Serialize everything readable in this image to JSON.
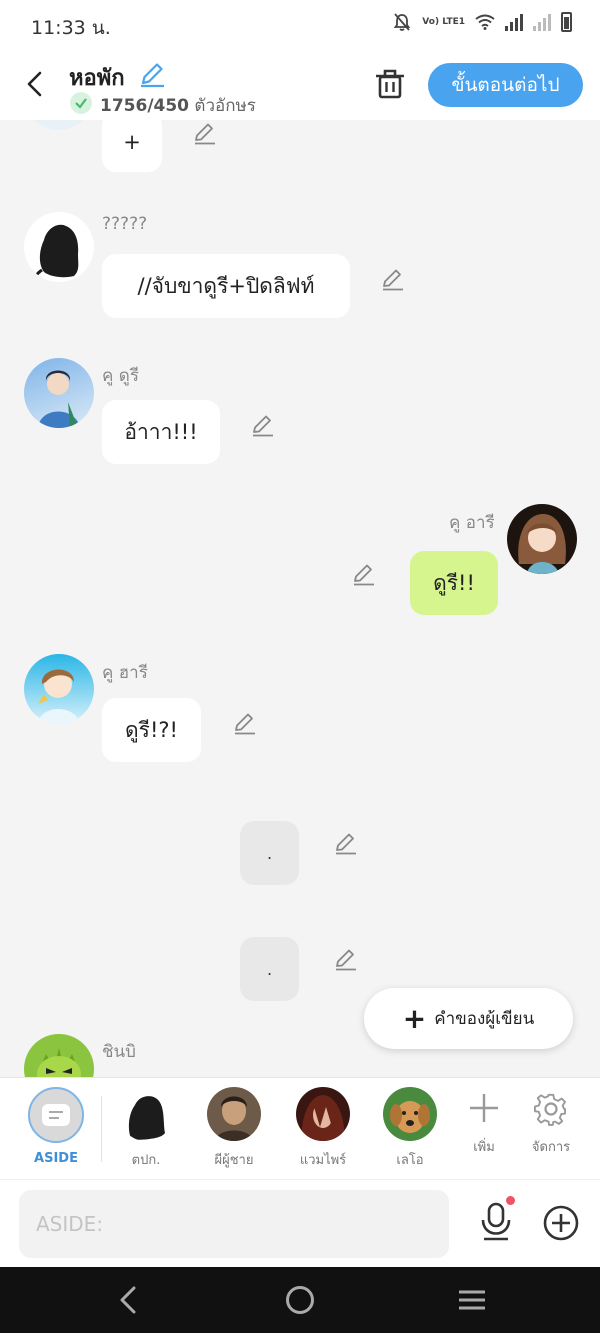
{
  "status_bar": {
    "time": "11:33 น.",
    "volte_label": "Vo) LTE1"
  },
  "header": {
    "title": "หอพัก",
    "char_count": "1756/450",
    "char_count_unit": "ตัวอักษร",
    "next_button": "ขั้นตอนต่อไป"
  },
  "messages": [
    {
      "sender": "",
      "text": "+",
      "side": "left"
    },
    {
      "sender": "?????",
      "text": "//จับขาดูรี+ปิดลิฟท์",
      "side": "left"
    },
    {
      "sender": "คู ดูรี",
      "text": "อ้าาา!!!",
      "side": "left"
    },
    {
      "sender": "คู อารี",
      "text": "ดูรี!!",
      "side": "right"
    },
    {
      "sender": "คู ฮารี",
      "text": "ดูรี!?!",
      "side": "left"
    },
    {
      "sender": "",
      "text": ".",
      "side": "center"
    },
    {
      "sender": "",
      "text": ".",
      "side": "center"
    },
    {
      "sender": "ชินบิ",
      "text": "",
      "side": "left"
    }
  ],
  "writer_button": {
    "label": "คำของผู้เขียน"
  },
  "characters": [
    {
      "label": "ASIDE",
      "active": true
    },
    {
      "label": "ตปก.",
      "active": false
    },
    {
      "label": "ผีผู้ชาย",
      "active": false
    },
    {
      "label": "แวมไพร์",
      "active": false
    },
    {
      "label": "เลโอ",
      "active": false
    }
  ],
  "actions": {
    "add_label": "เพิ่ม",
    "manage_label": "จัดการ"
  },
  "input": {
    "placeholder": "ASIDE:"
  },
  "colors": {
    "accent": "#4aa3ef",
    "own_bubble": "#d6f58e",
    "active_label": "#3f8fd8",
    "notification_dot": "#f05464"
  },
  "icons": [
    "back-icon",
    "pencil-icon",
    "check-icon",
    "trash-icon",
    "plus-icon",
    "gear-icon",
    "microphone-icon",
    "add-circle-icon"
  ]
}
